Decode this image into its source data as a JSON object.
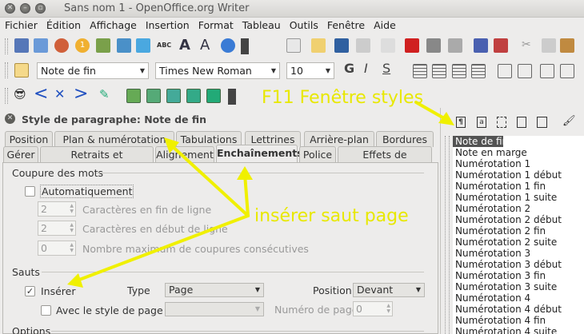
{
  "window": {
    "title": "Sans nom 1 - OpenOffice.org Writer"
  },
  "menu": [
    "Fichier",
    "Édition",
    "Affichage",
    "Insertion",
    "Format",
    "Tableau",
    "Outils",
    "Fenêtre",
    "Aide"
  ],
  "format_toolbar": {
    "paragraph_style": "Note de fin",
    "font_name": "Times New Roman",
    "font_size": "10"
  },
  "dialog": {
    "title": "Style de paragraphe: Note de fin",
    "tabs_row1": [
      "Position",
      "Plan & numérotation",
      "Tabulations",
      "Lettrines",
      "Arrière-plan",
      "Bordures"
    ],
    "tabs_row2": [
      "Gérer",
      "Retraits et espacement",
      "Alignement",
      "Enchaînements",
      "Police",
      "Effets de caractères"
    ],
    "active_tab": "Enchaînements",
    "hyphenation": {
      "section": "Coupure des mots",
      "auto_label": "Automatiquement",
      "auto_checked": false,
      "end_value": "2",
      "end_label": "Caractères en fin de ligne",
      "start_value": "2",
      "start_label": "Caractères en début de ligne",
      "max_value": "0",
      "max_label": "Nombre maximum de coupures consécutives"
    },
    "breaks": {
      "section": "Sauts",
      "insert_label": "Insérer",
      "insert_checked": true,
      "type_label": "Type",
      "type_value": "Page",
      "position_label": "Position",
      "position_value": "Devant",
      "page_style_label": "Avec le style de page",
      "page_style_value": "",
      "page_number_label": "Numéro de page",
      "page_number_value": "0"
    },
    "options_section": "Options"
  },
  "styles_panel": {
    "items": [
      "Note de fin",
      "Note en marge",
      "Numérotation 1",
      "Numérotation 1 début",
      "Numérotation 1 fin",
      "Numérotation 1 suite",
      "Numérotation 2",
      "Numérotation 2 début",
      "Numérotation 2 fin",
      "Numérotation 2 suite",
      "Numérotation 3",
      "Numérotation 3 début",
      "Numérotation 3 fin",
      "Numérotation 3 suite",
      "Numérotation 4",
      "Numérotation 4 début",
      "Numérotation 4 fin",
      "Numérotation 4 suite"
    ],
    "selected": "Note de fin"
  },
  "annotations": {
    "f11": "F11 Fenêtre styles",
    "page_break": "insérer saut page"
  },
  "colors": {
    "annotation": "#e8e800",
    "selection": "#535353"
  }
}
